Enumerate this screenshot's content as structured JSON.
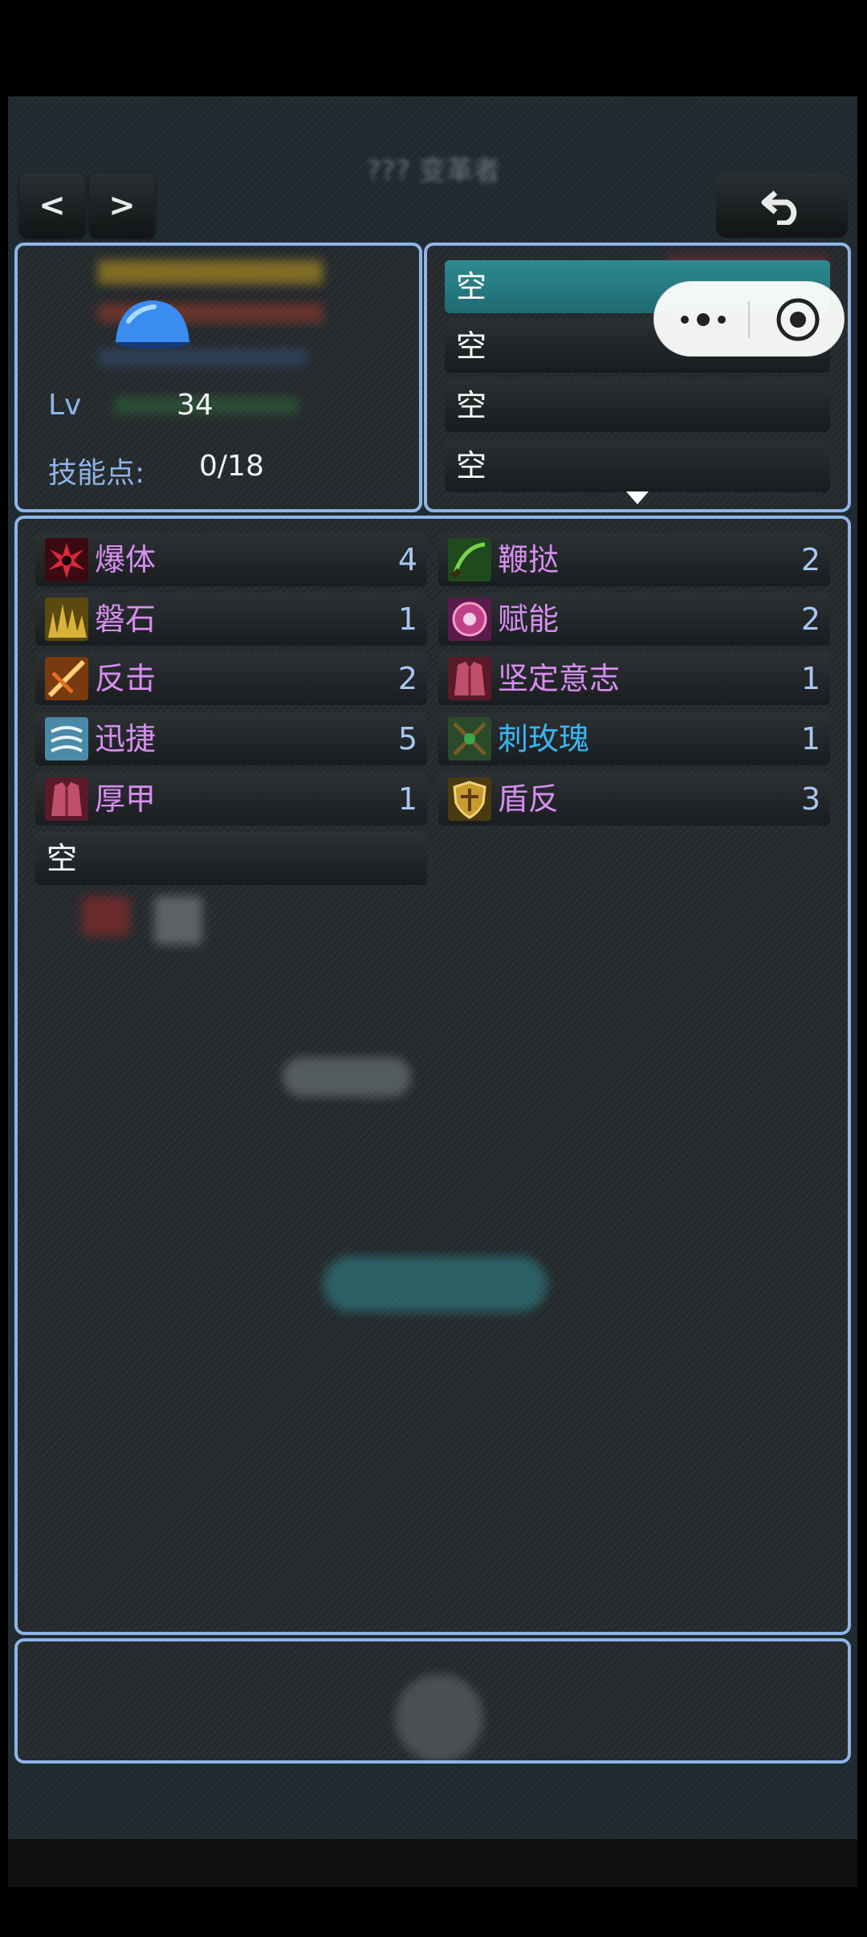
{
  "header": {
    "title_blurred": "??? 变革者",
    "prev_label": "<",
    "next_label": ">",
    "back_icon": "undo-arrow-icon"
  },
  "character": {
    "avatar_icon": "blue-slime-icon",
    "level_label": "Lv",
    "level_value": "34",
    "skill_points_label": "技能点:",
    "skill_points_value": "0/18"
  },
  "slots": [
    {
      "label": "空",
      "active": true
    },
    {
      "label": "空",
      "active": false
    },
    {
      "label": "空",
      "active": false
    },
    {
      "label": "空",
      "active": false
    }
  ],
  "skills_left": [
    {
      "name": "爆体",
      "level": "4",
      "icon": "red-burst-icon",
      "color": "#d78ef0"
    },
    {
      "name": "磐石",
      "level": "1",
      "icon": "rock-spikes-icon",
      "color": "#d78ef0"
    },
    {
      "name": "反击",
      "level": "2",
      "icon": "counter-slash-icon",
      "color": "#d78ef0"
    },
    {
      "name": "迅捷",
      "level": "5",
      "icon": "swift-wind-icon",
      "color": "#d78ef0"
    },
    {
      "name": "厚甲",
      "level": "1",
      "icon": "armor-vest-icon",
      "color": "#d78ef0"
    }
  ],
  "skills_right": [
    {
      "name": "鞭挞",
      "level": "2",
      "icon": "whip-icon",
      "color": "#d78ef0"
    },
    {
      "name": "赋能",
      "level": "2",
      "icon": "empower-rune-icon",
      "color": "#d78ef0"
    },
    {
      "name": "坚定意志",
      "level": "1",
      "icon": "armor-vest-icon",
      "color": "#d78ef0"
    },
    {
      "name": "刺玫瑰",
      "level": "1",
      "icon": "thorn-rose-icon",
      "color": "#3ab6f2"
    },
    {
      "name": "盾反",
      "level": "3",
      "icon": "shield-icon",
      "color": "#d78ef0"
    }
  ],
  "empty_skill_label": "空",
  "capsule": {
    "more_icon": "more-dots-icon",
    "close_icon": "target-close-icon"
  },
  "colors": {
    "panel_border": "#8fb4e8",
    "active_slot": "#2e8a90",
    "skill_purple": "#d78ef0",
    "skill_blue": "#3ab6f2"
  }
}
